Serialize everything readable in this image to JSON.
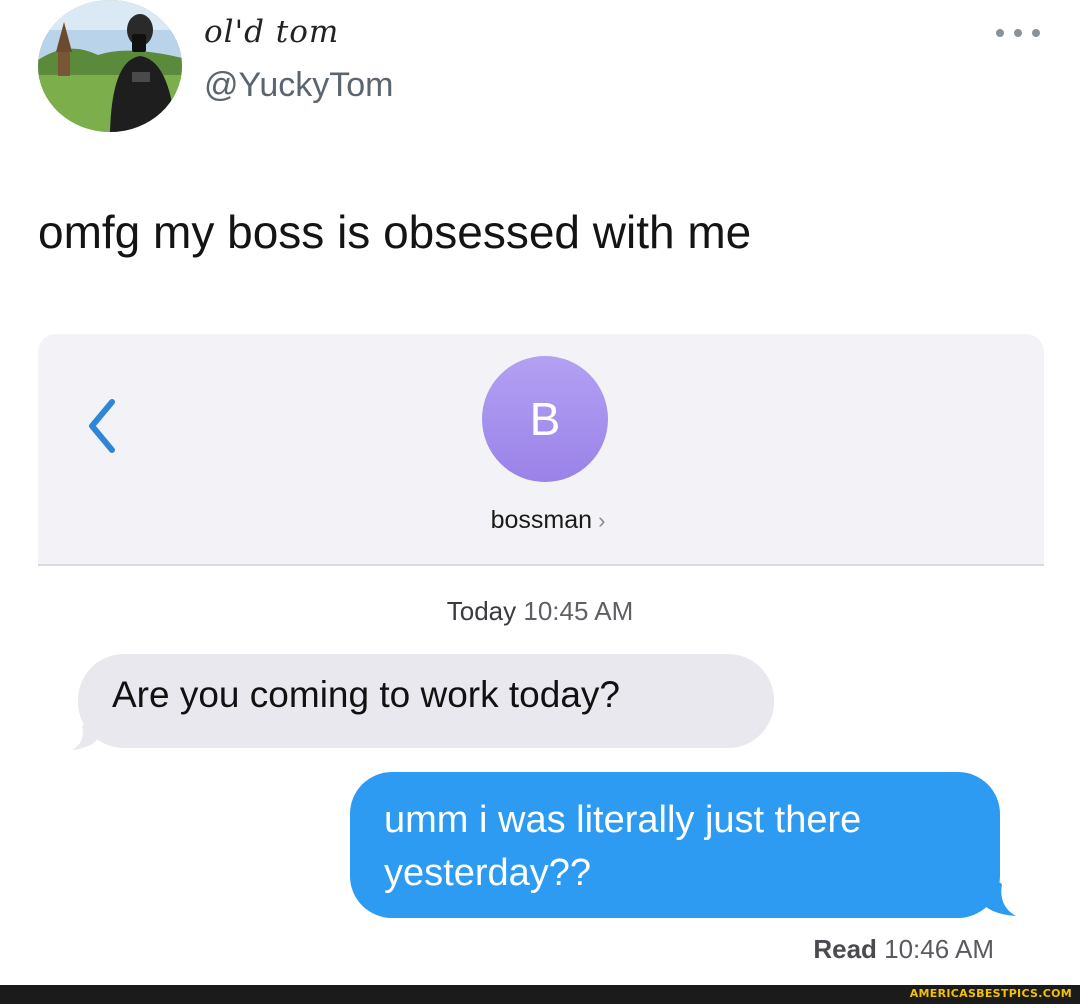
{
  "tweet": {
    "display_name": "ol'd tom",
    "handle": "@YuckyTom",
    "text": "omfg my boss is obsessed with me",
    "more_icon": "more-horizontal-icon"
  },
  "conversation": {
    "back_icon": "chevron-left-icon",
    "contact_initial": "B",
    "contact_name": "bossman",
    "contact_chevron": "›",
    "timestamp_day": "Today",
    "timestamp_time": "10:45 AM",
    "messages": [
      {
        "direction": "incoming",
        "text": "Are you coming to work today?"
      },
      {
        "direction": "outgoing",
        "text": "umm i was literally just there yesterday??"
      }
    ],
    "read_receipt_label": "Read",
    "read_receipt_time": "10:46 AM"
  },
  "watermark": {
    "text": "AMERICASBESTPICS.COM"
  },
  "colors": {
    "incoming_bubble": "#e9e8ee",
    "outgoing_bubble": "#2e9bf3",
    "contact_avatar": "#a48ded",
    "ios_blue": "#2f86d6",
    "watermark": "#f5c000"
  }
}
